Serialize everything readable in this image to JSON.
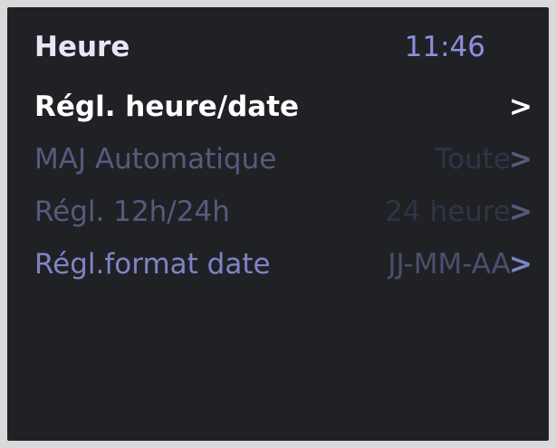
{
  "header": {
    "title": "Heure",
    "time": "11:46"
  },
  "menu": {
    "items": [
      {
        "label": "Régl. heure/date",
        "value": "",
        "chevron": ">"
      },
      {
        "label": "MAJ Automatique",
        "value": "Toute",
        "chevron": ">"
      },
      {
        "label": "Régl. 12h/24h",
        "value": "24 heure",
        "chevron": ">"
      },
      {
        "label": "Régl.format date",
        "value": "JJ-MM-AA",
        "chevron": ">"
      }
    ]
  },
  "colors": {
    "background": "#202125",
    "title": "#e7e6f6",
    "clock": "#8c8fe0",
    "selected": "#ffffff",
    "unselected": "#7f84c7",
    "disabled": "#575a7e"
  }
}
